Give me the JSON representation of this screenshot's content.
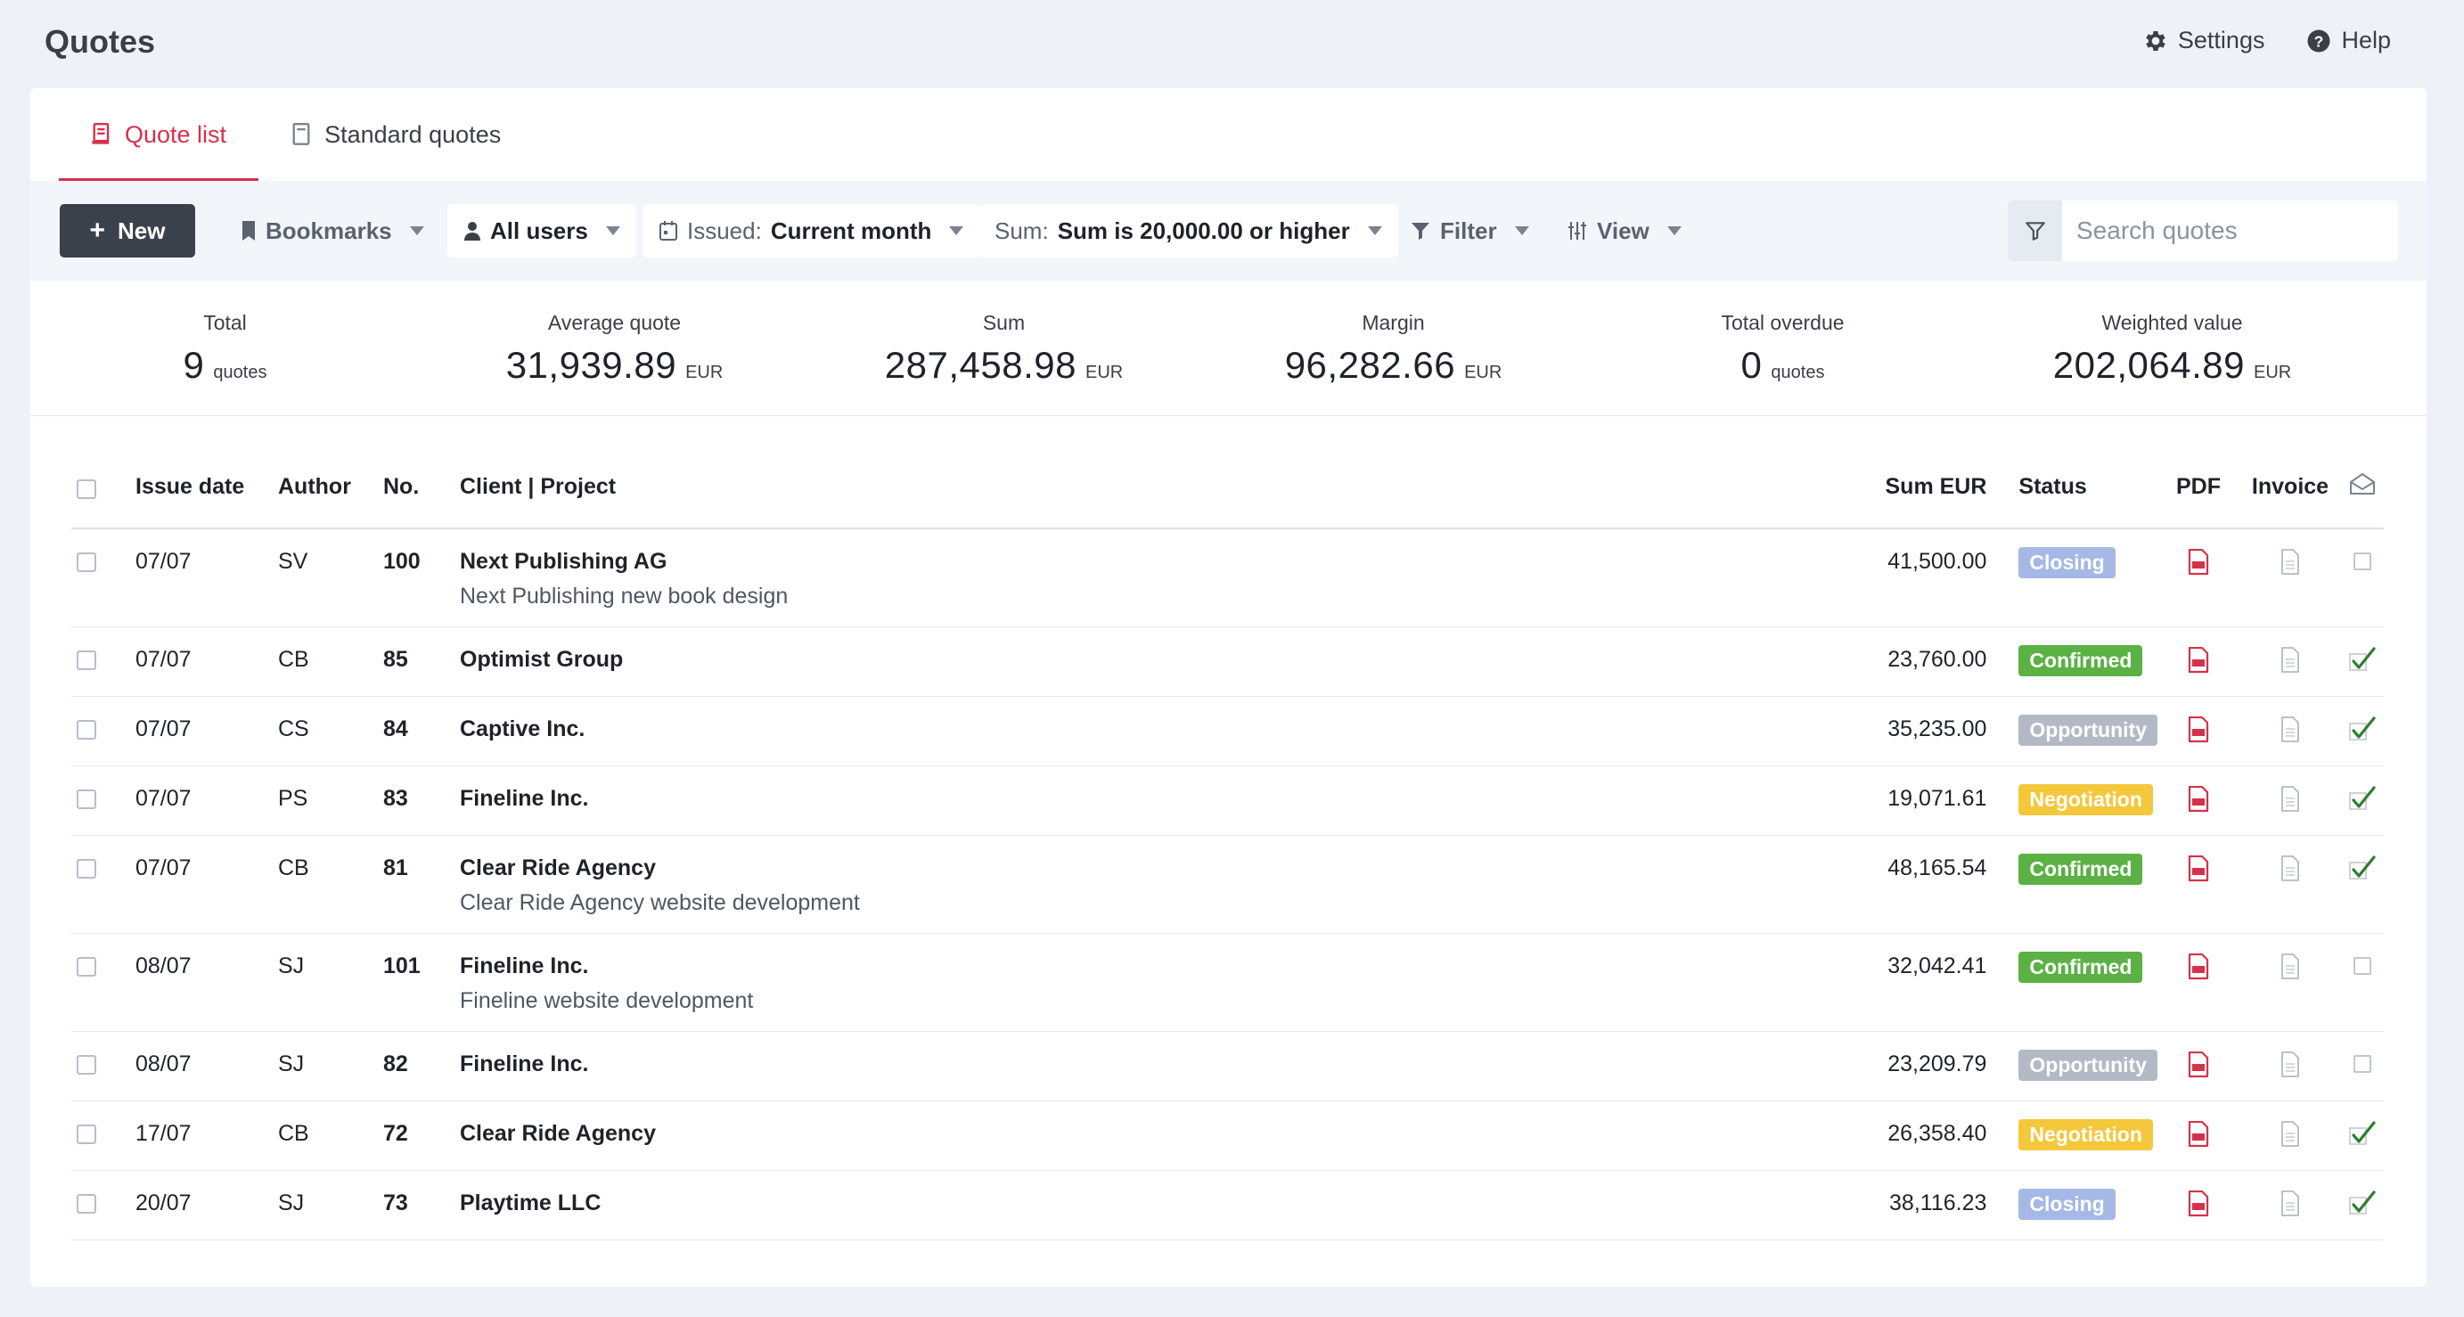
{
  "page": {
    "title": "Quotes",
    "settings_label": "Settings",
    "help_label": "Help"
  },
  "tabs": [
    {
      "label": "Quote list",
      "icon": "quote-list-icon",
      "active": true
    },
    {
      "label": "Standard quotes",
      "icon": "document-icon",
      "active": false
    }
  ],
  "toolbar": {
    "new_label": "New",
    "bookmarks_label": "Bookmarks",
    "users_label": "All users",
    "issued_prefix": "Issued:",
    "issued_value": "Current month",
    "sum_prefix": "Sum:",
    "sum_value": "Sum is 20,000.00 or higher",
    "filter_label": "Filter",
    "view_label": "View",
    "search_placeholder": "Search quotes"
  },
  "stats": [
    {
      "label": "Total",
      "value": "9",
      "unit": "quotes"
    },
    {
      "label": "Average quote",
      "value": "31,939.89",
      "unit": "EUR"
    },
    {
      "label": "Sum",
      "value": "287,458.98",
      "unit": "EUR"
    },
    {
      "label": "Margin",
      "value": "96,282.66",
      "unit": "EUR"
    },
    {
      "label": "Total overdue",
      "value": "0",
      "unit": "quotes"
    },
    {
      "label": "Weighted value",
      "value": "202,064.89",
      "unit": "EUR"
    }
  ],
  "table": {
    "headers": {
      "issue_date": "Issue date",
      "author": "Author",
      "no": "No.",
      "client_project": "Client | Project",
      "sum": "Sum EUR",
      "status": "Status",
      "pdf": "PDF",
      "invoice": "Invoice"
    },
    "rows": [
      {
        "date": "07/07",
        "author": "SV",
        "no": "100",
        "client": "Next Publishing AG",
        "project": "Next Publishing new book design",
        "sum": "41,500.00",
        "status": "Closing",
        "sent": false
      },
      {
        "date": "07/07",
        "author": "CB",
        "no": "85",
        "client": "Optimist Group",
        "project": "",
        "sum": "23,760.00",
        "status": "Confirmed",
        "sent": true
      },
      {
        "date": "07/07",
        "author": "CS",
        "no": "84",
        "client": "Captive Inc.",
        "project": "",
        "sum": "35,235.00",
        "status": "Opportunity",
        "sent": true
      },
      {
        "date": "07/07",
        "author": "PS",
        "no": "83",
        "client": "Fineline Inc.",
        "project": "",
        "sum": "19,071.61",
        "status": "Negotiation",
        "sent": true
      },
      {
        "date": "07/07",
        "author": "CB",
        "no": "81",
        "client": "Clear Ride Agency",
        "project": "Clear Ride Agency website development",
        "sum": "48,165.54",
        "status": "Confirmed",
        "sent": true
      },
      {
        "date": "08/07",
        "author": "SJ",
        "no": "101",
        "client": "Fineline Inc.",
        "project": "Fineline website development",
        "sum": "32,042.41",
        "status": "Confirmed",
        "sent": false
      },
      {
        "date": "08/07",
        "author": "SJ",
        "no": "82",
        "client": "Fineline Inc.",
        "project": "",
        "sum": "23,209.79",
        "status": "Opportunity",
        "sent": false
      },
      {
        "date": "17/07",
        "author": "CB",
        "no": "72",
        "client": "Clear Ride Agency",
        "project": "",
        "sum": "26,358.40",
        "status": "Negotiation",
        "sent": true
      },
      {
        "date": "20/07",
        "author": "SJ",
        "no": "73",
        "client": "Playtime LLC",
        "project": "",
        "sum": "38,116.23",
        "status": "Closing",
        "sent": true
      }
    ]
  },
  "status_colors": {
    "Closing": "#a5b8e6",
    "Confirmed": "#5bb144",
    "Opportunity": "#b3bac6",
    "Negotiation": "#f4c83a"
  },
  "colors": {
    "accent": "#d6314b",
    "primary_button": "#3b414b",
    "check_green": "#2e7d32"
  }
}
